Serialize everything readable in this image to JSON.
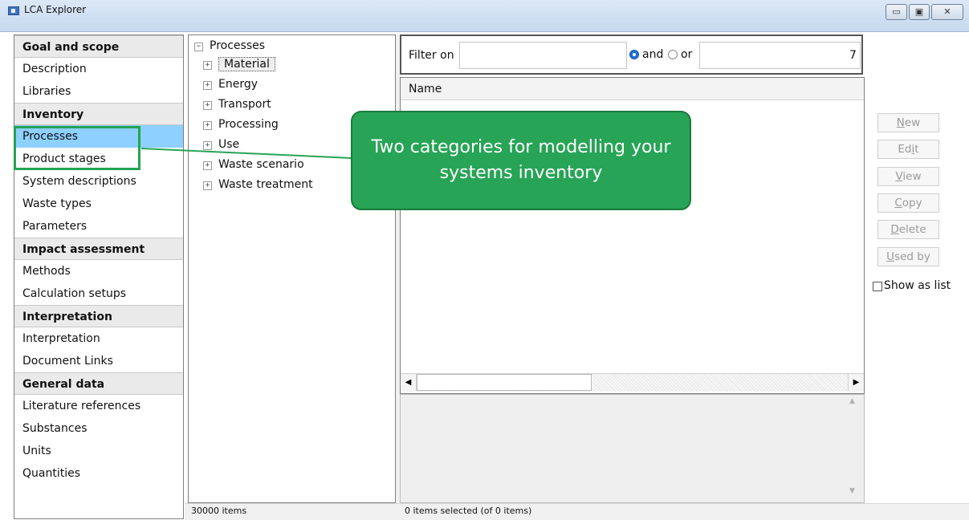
{
  "window": {
    "title": "LCA Explorer",
    "buttons": {
      "minimize": "▭",
      "maximize": "▣",
      "close": "✕"
    }
  },
  "sidebar": {
    "sections": [
      {
        "label": "Goal and scope",
        "items": [
          "Description",
          "Libraries"
        ]
      },
      {
        "label": "Inventory",
        "items": [
          "Processes",
          "Product stages",
          "System descriptions",
          "Waste types",
          "Parameters"
        ]
      },
      {
        "label": "Impact assessment",
        "items": [
          "Methods",
          "Calculation setups"
        ]
      },
      {
        "label": "Interpretation",
        "items": [
          "Interpretation",
          "Document Links"
        ]
      },
      {
        "label": "General data",
        "items": [
          "Literature references",
          "Substances",
          "Units",
          "Quantities"
        ]
      }
    ],
    "selected": "Processes"
  },
  "tree": {
    "root": "Processes",
    "items": [
      "Material",
      "Energy",
      "Transport",
      "Processing",
      "Use",
      "Waste scenario",
      "Waste treatment"
    ],
    "selected": "Material",
    "collapse_glyph": "−",
    "expand_glyph": "+"
  },
  "filter": {
    "label": "Filter on",
    "value1": "",
    "and_label": "and",
    "or_label": "or",
    "selected_mode": "and",
    "value2": "7"
  },
  "list": {
    "columns": [
      "Name"
    ],
    "rows": []
  },
  "actions": {
    "new": {
      "pre": "",
      "key": "N",
      "post": "ew"
    },
    "edit": {
      "pre": "Ed",
      "key": "i",
      "post": "t"
    },
    "view": {
      "pre": "",
      "key": "V",
      "post": "iew"
    },
    "copy": {
      "pre": "",
      "key": "C",
      "post": "opy"
    },
    "delete": {
      "pre": "",
      "key": "D",
      "post": "elete"
    },
    "used_by": {
      "pre": "",
      "key": "U",
      "post": "sed by"
    },
    "show_as_list": "Show as list",
    "show_as_list_checked": false
  },
  "status": {
    "tree_count": "30000 items",
    "selection": "0 items selected (of 0 items)"
  },
  "callout": {
    "text": "Two categories for modelling your systems inventory",
    "color": "#27a456"
  }
}
